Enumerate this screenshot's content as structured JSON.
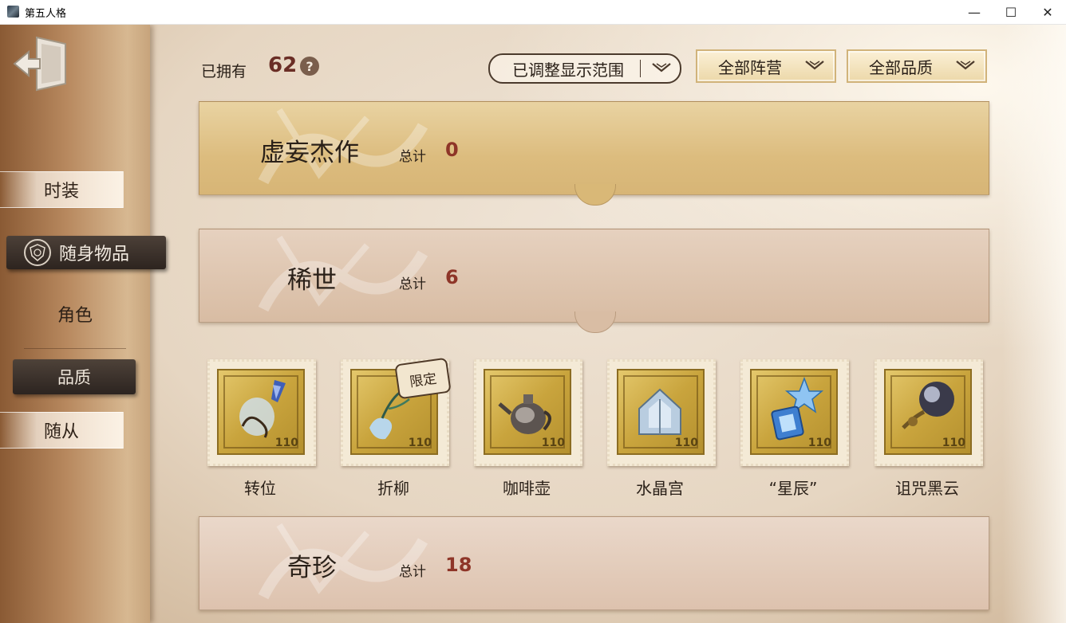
{
  "window": {
    "title": "第五人格",
    "min_glyph": "—",
    "max_glyph": "☐",
    "close_glyph": "✕"
  },
  "sidebar": {
    "exit_icon": "exit-door-icon",
    "tabs": [
      {
        "label": "时装",
        "state": "normal"
      },
      {
        "label": "随身物品",
        "state": "selected"
      },
      {
        "label": "角色",
        "state": "plain"
      },
      {
        "label": "品质",
        "state": "selected-dark"
      },
      {
        "label": "随从",
        "state": "normal"
      }
    ]
  },
  "header": {
    "owned_label": "已拥有",
    "owned_count": "62",
    "help_glyph": "?",
    "filters": {
      "range": "已调整显示范围",
      "faction": "全部阵营",
      "quality": "全部品质"
    }
  },
  "categories": [
    {
      "name": "虚妄杰作",
      "total_label": "总计",
      "total": "0",
      "color": "#dcbc7e"
    },
    {
      "name": "稀世",
      "total_label": "总计",
      "total": "6",
      "color": "#d8bca3"
    },
    {
      "name": "奇珍",
      "total_label": "总计",
      "total": "18",
      "color": "#ddc2ae"
    }
  ],
  "items": [
    {
      "name": "转位",
      "limited": false,
      "icon": "wand-crystal-icon"
    },
    {
      "name": "折柳",
      "limited": true,
      "badge": "限定",
      "icon": "willow-vase-icon"
    },
    {
      "name": "咖啡壶",
      "limited": false,
      "icon": "coffee-pot-icon"
    },
    {
      "name": "水晶宫",
      "limited": false,
      "icon": "crystal-palace-icon"
    },
    {
      "name": "“星辰”",
      "limited": false,
      "icon": "star-lantern-icon"
    },
    {
      "name": "诅咒黑云",
      "limited": false,
      "icon": "cursed-orb-icon"
    }
  ],
  "stamp_mark": "110",
  "colors": {
    "accent_number": "#8e3528",
    "dark_tab": "#2d241f",
    "gold_stamp": "#c9a43d"
  }
}
